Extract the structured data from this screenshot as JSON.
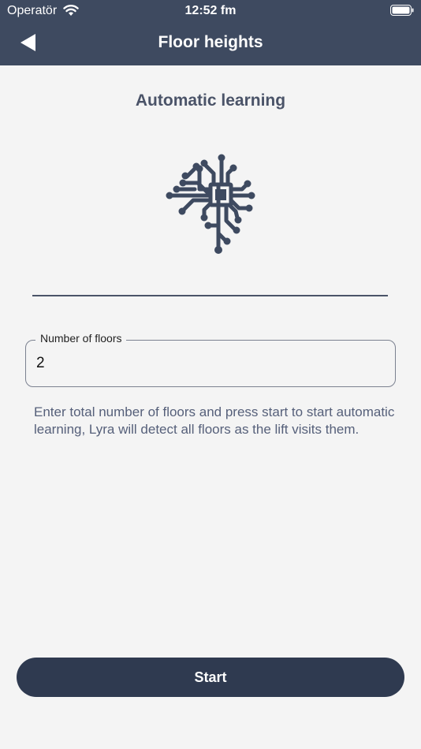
{
  "status_bar": {
    "carrier": "Operatör",
    "time": "12:52 fm",
    "icons": [
      "wifi-icon",
      "battery-icon"
    ]
  },
  "nav": {
    "back_icon": "back-arrow-icon",
    "title": "Floor heights"
  },
  "main": {
    "section_title": "Automatic learning",
    "illustration_icon": "circuit-brain-icon",
    "floors_field": {
      "label": "Number of floors",
      "value": "2"
    },
    "help_text": "Enter total number of floors and press start to start automatic learning, Lyra will detect all floors as the lift visits them.",
    "start_label": "Start"
  },
  "colors": {
    "header_bg": "#3e4a60",
    "background": "#f4f4f4",
    "accent": "#4a5368",
    "button_bg": "#2f3a50"
  }
}
